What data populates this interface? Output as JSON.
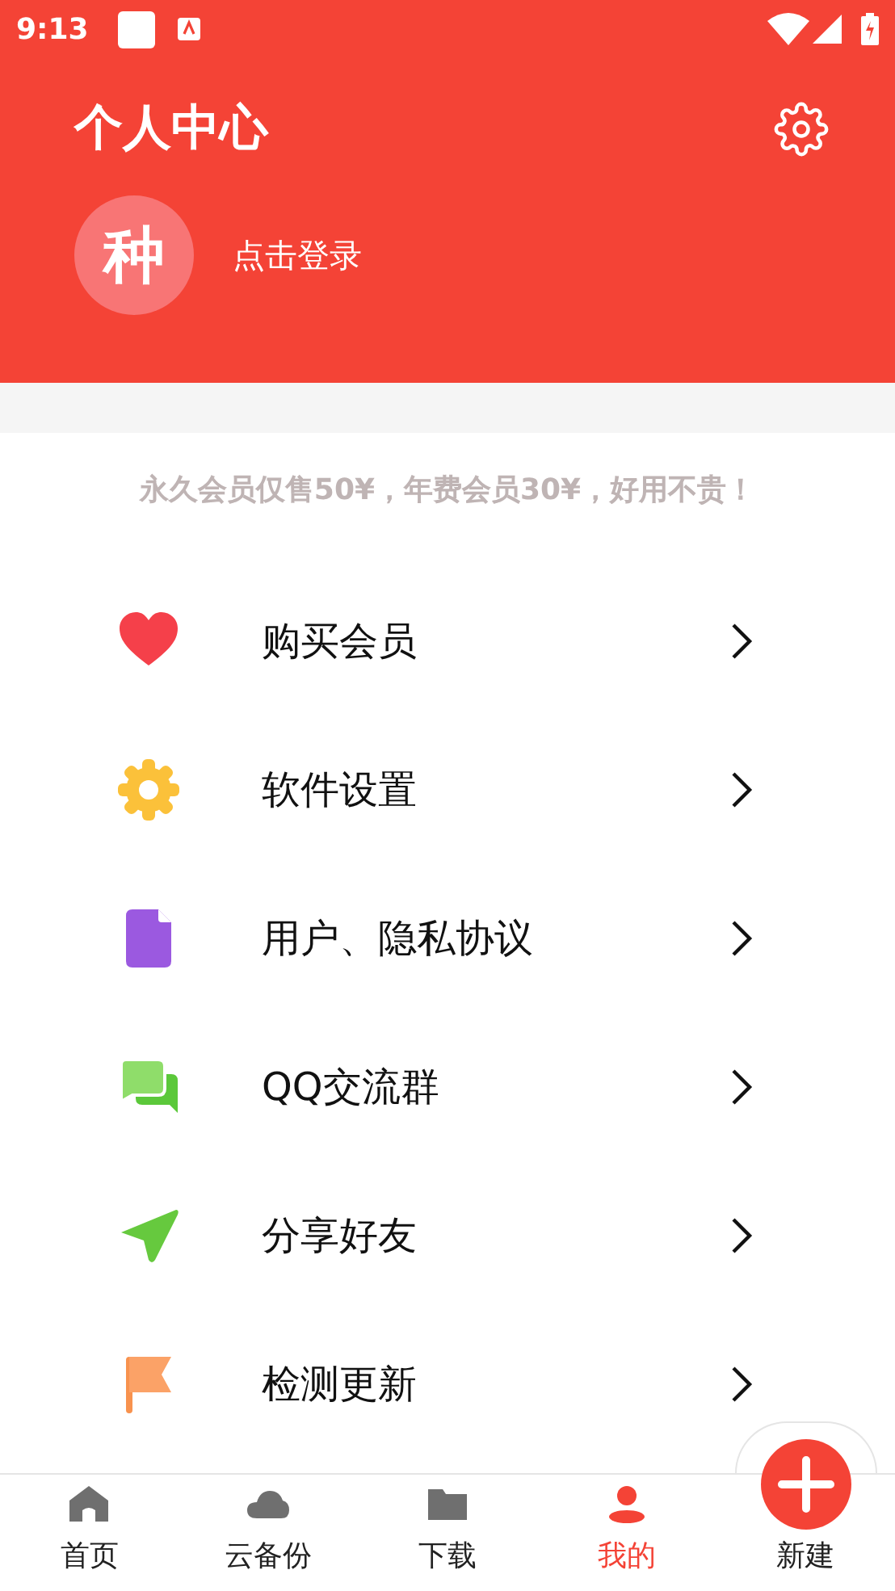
{
  "status_bar": {
    "time": "9:13"
  },
  "header": {
    "title": "个人中心",
    "avatar_char": "种",
    "login": "点击登录"
  },
  "promo": "永久会员仅售50¥，年费会员30¥，好用不贵！",
  "menu": [
    {
      "kind": "heart",
      "label": "购买会员"
    },
    {
      "kind": "gear",
      "label": "软件设置"
    },
    {
      "kind": "document",
      "label": "用户、隐私协议"
    },
    {
      "kind": "chat",
      "label": "QQ交流群"
    },
    {
      "kind": "send",
      "label": "分享好友"
    },
    {
      "kind": "flag",
      "label": "检测更新"
    }
  ],
  "bottom_nav": [
    {
      "kind": "home",
      "label": "首页",
      "selected": false
    },
    {
      "kind": "cloud",
      "label": "云备份",
      "selected": false
    },
    {
      "kind": "folder",
      "label": "下载",
      "selected": false
    },
    {
      "kind": "person",
      "label": "我的",
      "selected": true
    },
    {
      "kind": "add",
      "label": "新建",
      "selected": false
    }
  ]
}
